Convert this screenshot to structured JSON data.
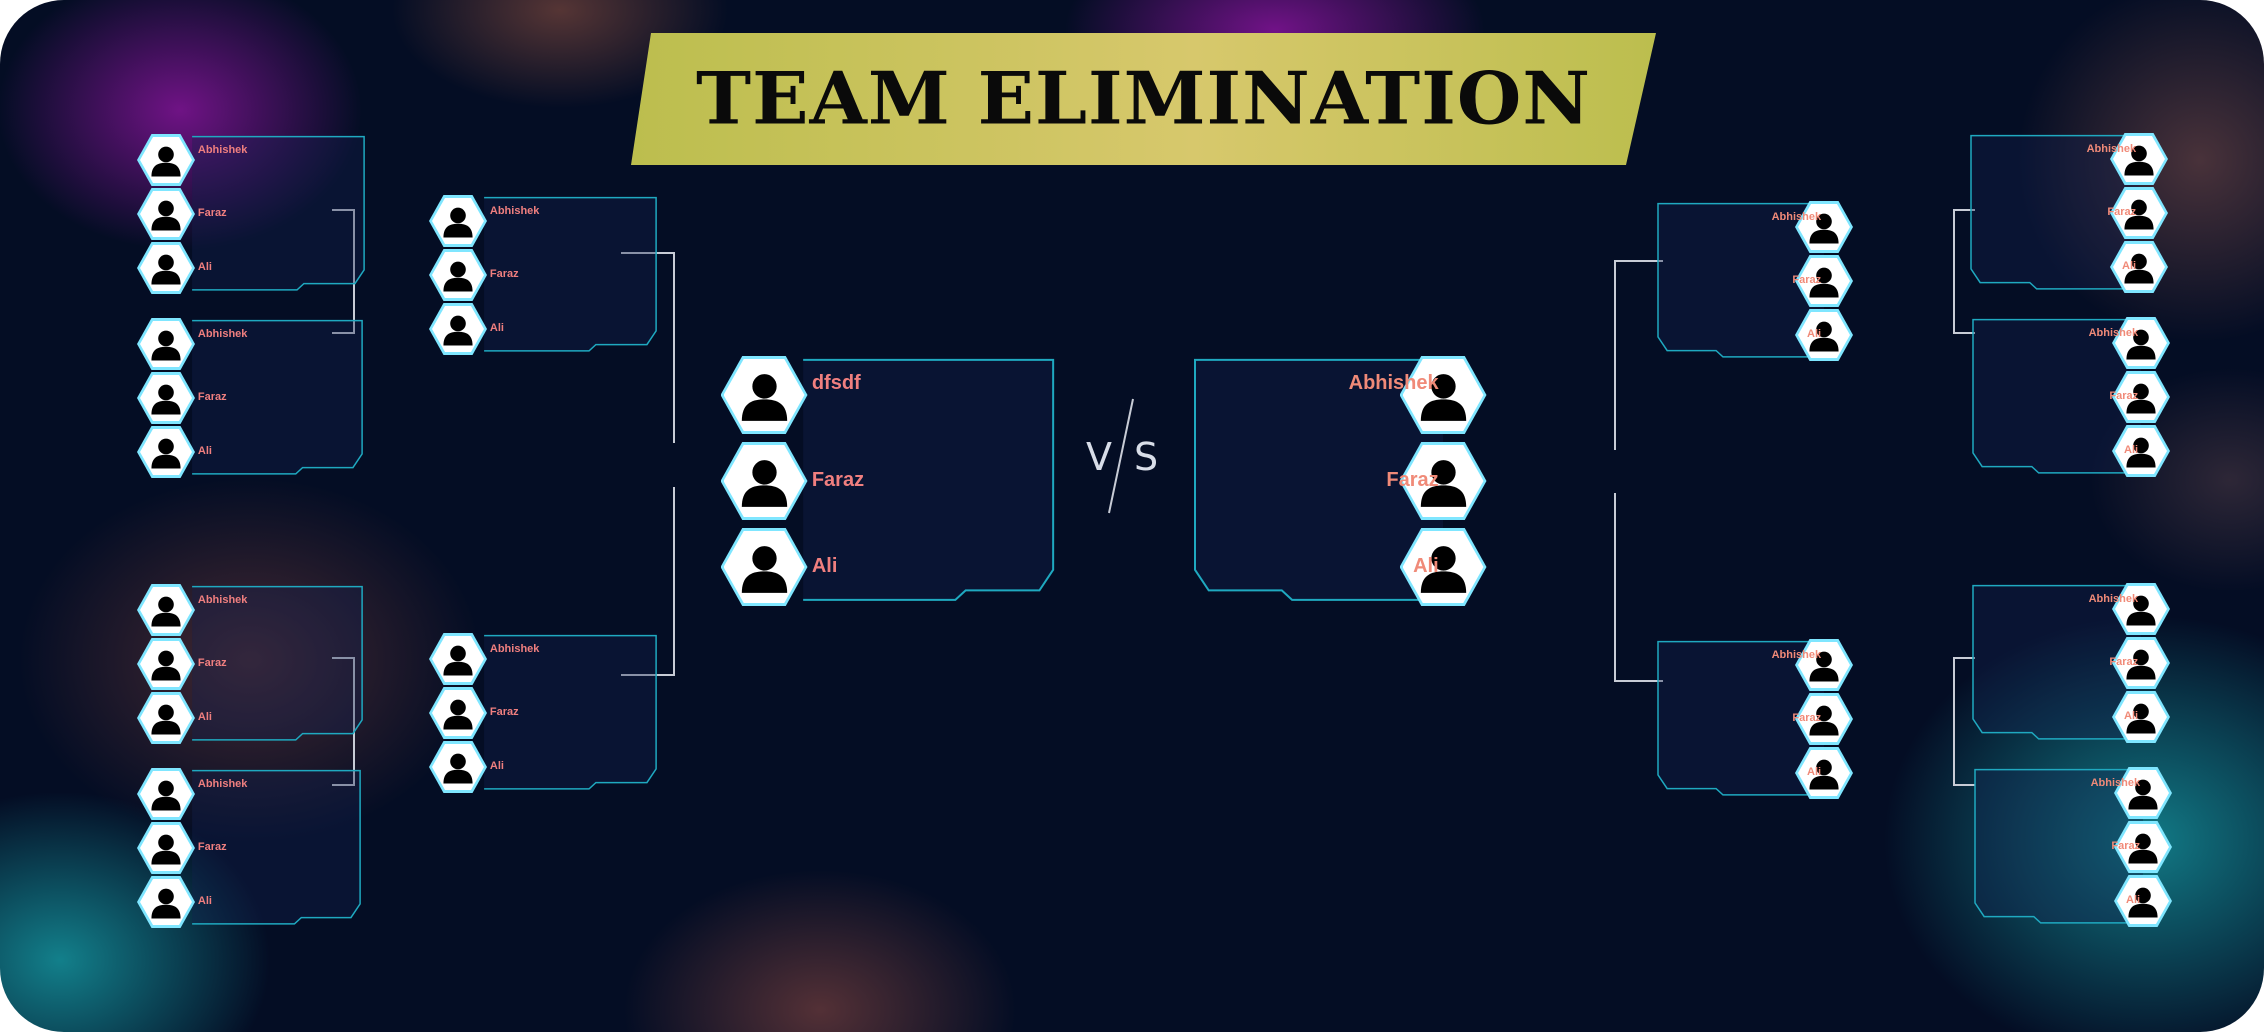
{
  "title": "TEAM ELIMINATION",
  "vs_left": "V",
  "vs_right": "S",
  "left_round1": [
    {
      "players": [
        "Abhishek",
        "Faraz",
        "Ali"
      ]
    },
    {
      "players": [
        "Abhishek",
        "Faraz",
        "Ali"
      ]
    },
    {
      "players": [
        "Abhishek",
        "Faraz",
        "Ali"
      ]
    },
    {
      "players": [
        "Abhishek",
        "Faraz",
        "Ali"
      ]
    }
  ],
  "left_round2": [
    {
      "players": [
        "Abhishek",
        "Faraz",
        "Ali"
      ]
    },
    {
      "players": [
        "Abhishek",
        "Faraz",
        "Ali"
      ]
    }
  ],
  "final_left": {
    "players": [
      "dfsdf",
      "Faraz",
      "Ali"
    ]
  },
  "final_right": {
    "players": [
      "Abhishek",
      "Faraz",
      "Ali"
    ]
  },
  "right_round2": [
    {
      "players": [
        "Abhishek",
        "Faraz",
        "Ali"
      ]
    },
    {
      "players": [
        "Abhishek",
        "Faraz",
        "Ali"
      ]
    }
  ],
  "right_round1": [
    {
      "players": [
        "Abhishek",
        "Faraz",
        "Ali"
      ]
    },
    {
      "players": [
        "Abhishek",
        "Faraz",
        "Ali"
      ]
    },
    {
      "players": [
        "Abhishek",
        "Faraz",
        "Ali"
      ]
    },
    {
      "players": [
        "Abhishek",
        "Faraz",
        "Ali"
      ]
    }
  ],
  "colors": {
    "background": "#040d24",
    "banner": "#c9c35a",
    "card_border": "#1fa9c0",
    "avatar_border": "#7fe6ff",
    "name_text": "#f07f7f",
    "connector": "#c8ccd6"
  },
  "icons": {
    "avatar": "user-silhouette-icon"
  }
}
